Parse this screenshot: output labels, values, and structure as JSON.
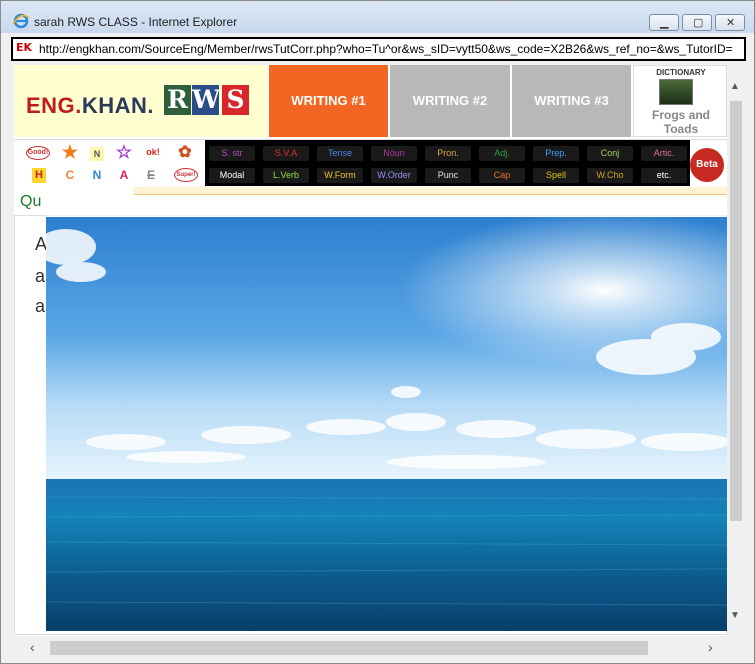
{
  "window": {
    "title": "sarah RWS CLASS - Internet Explorer",
    "url": "http://engkhan.com/SourceEng/Member/rwsTutCorr.php?who=Tu^or&ws_sID=vytt50&ws_code=X2B26&ws_ref_no=&ws_TutorID="
  },
  "logo": {
    "eng": "ENG",
    "dot": ".",
    "khan": "KHAN.",
    "r": "R",
    "w": "W",
    "s": "S"
  },
  "tabs": [
    "WRITING #1",
    "WRITING #2",
    "WRITING #3"
  ],
  "dictionary": {
    "label": "DICTIONARY",
    "word_line1": "Frogs and",
    "word_line2": "Toads"
  },
  "stickers": {
    "row1": [
      "Good!",
      "★",
      "N",
      "☆",
      "ok!",
      "✿"
    ],
    "row2": [
      "H",
      "C",
      "N",
      "A",
      "E",
      "Super!"
    ]
  },
  "grammar": {
    "row1": [
      "S. str",
      "S.V.A",
      "Tense",
      "Noun",
      "Pron.",
      "Adj.",
      "Prep.",
      "Conj",
      "Artic."
    ],
    "row2": [
      "Modal",
      "L.Verb",
      "W.Form",
      "W.Order",
      "Punc",
      "Cap",
      "Spell",
      "W.Cho",
      "etc."
    ],
    "row1_colors": [
      "#c044d0",
      "#e0302a",
      "#4e82e8",
      "#b03aa0",
      "#e0a050",
      "#2fa040",
      "#3fa0ff",
      "#a0d060",
      "#e070a0"
    ],
    "row2_colors": [
      "#ffffff",
      "#8fe040",
      "#f0c030",
      "#9090ff",
      "#e0e0e0",
      "#f07020",
      "#e0c020",
      "#d0a020",
      "#ffffff"
    ]
  },
  "beta_button": "Beta",
  "section": {
    "title_partial": "Qu"
  },
  "body_letters": [
    "A",
    "a",
    "a"
  ]
}
